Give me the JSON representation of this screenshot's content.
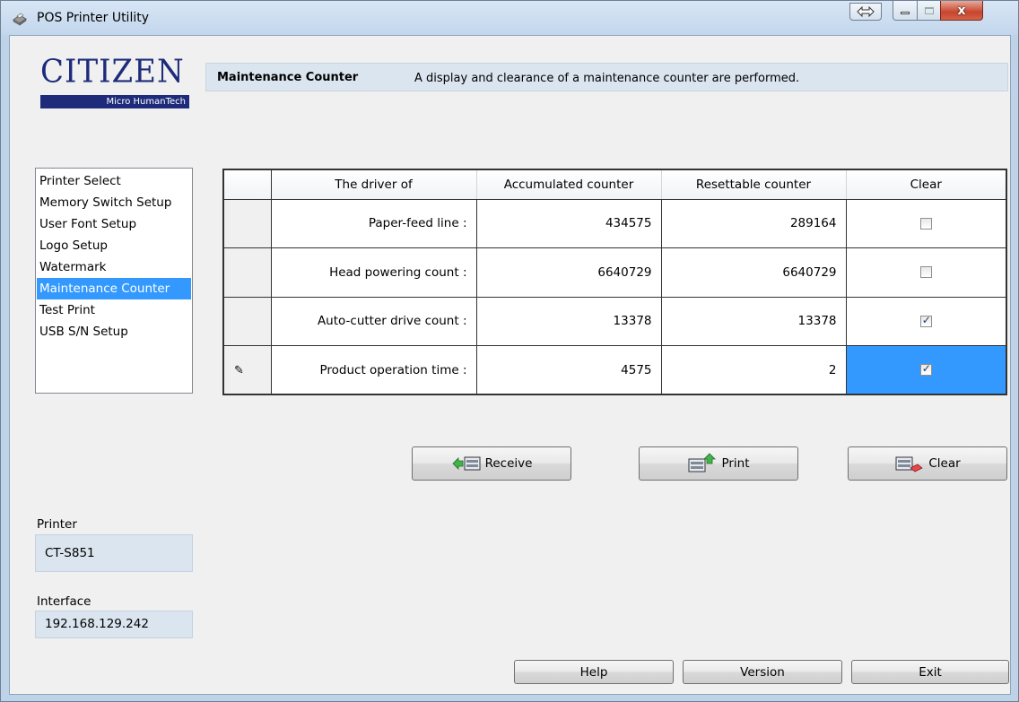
{
  "window": {
    "title": "POS Printer Utility"
  },
  "logo": {
    "brand": "CITIZEN",
    "subtitle": "Micro HumanTech"
  },
  "header": {
    "title": "Maintenance Counter",
    "description": "A display and clearance of a maintenance counter are performed."
  },
  "sidebar": {
    "items": [
      {
        "label": "Printer Select",
        "selected": false
      },
      {
        "label": "Memory Switch Setup",
        "selected": false
      },
      {
        "label": "User Font Setup",
        "selected": false
      },
      {
        "label": "Logo Setup",
        "selected": false
      },
      {
        "label": "Watermark",
        "selected": false
      },
      {
        "label": "Maintenance Counter",
        "selected": true
      },
      {
        "label": "Test Print",
        "selected": false
      },
      {
        "label": "USB S/N Setup",
        "selected": false
      }
    ]
  },
  "table": {
    "columns": [
      "The driver of",
      "Accumulated counter",
      "Resettable counter",
      "Clear"
    ],
    "rows": [
      {
        "label": "Paper-feed line :",
        "accumulated": "434575",
        "resettable": "289164",
        "clear": false
      },
      {
        "label": "Head powering count :",
        "accumulated": "6640729",
        "resettable": "6640729",
        "clear": false
      },
      {
        "label": "Auto-cutter drive count :",
        "accumulated": "13378",
        "resettable": "13378",
        "clear": true
      },
      {
        "label": "Product operation time :",
        "accumulated": "4575",
        "resettable": "2",
        "clear": true
      }
    ]
  },
  "actions": {
    "receive_label": "Receive",
    "print_label": "Print",
    "clear_label": "Clear"
  },
  "printer": {
    "label": "Printer",
    "value": "CT-S851"
  },
  "interface": {
    "label": "Interface",
    "value": "192.168.129.242"
  },
  "footer": {
    "help_label": "Help",
    "version_label": "Version",
    "exit_label": "Exit"
  },
  "colors": {
    "selection": "#3399ff",
    "header_band": "#dbe5ef",
    "logo_blue": "#1d2b7a"
  }
}
